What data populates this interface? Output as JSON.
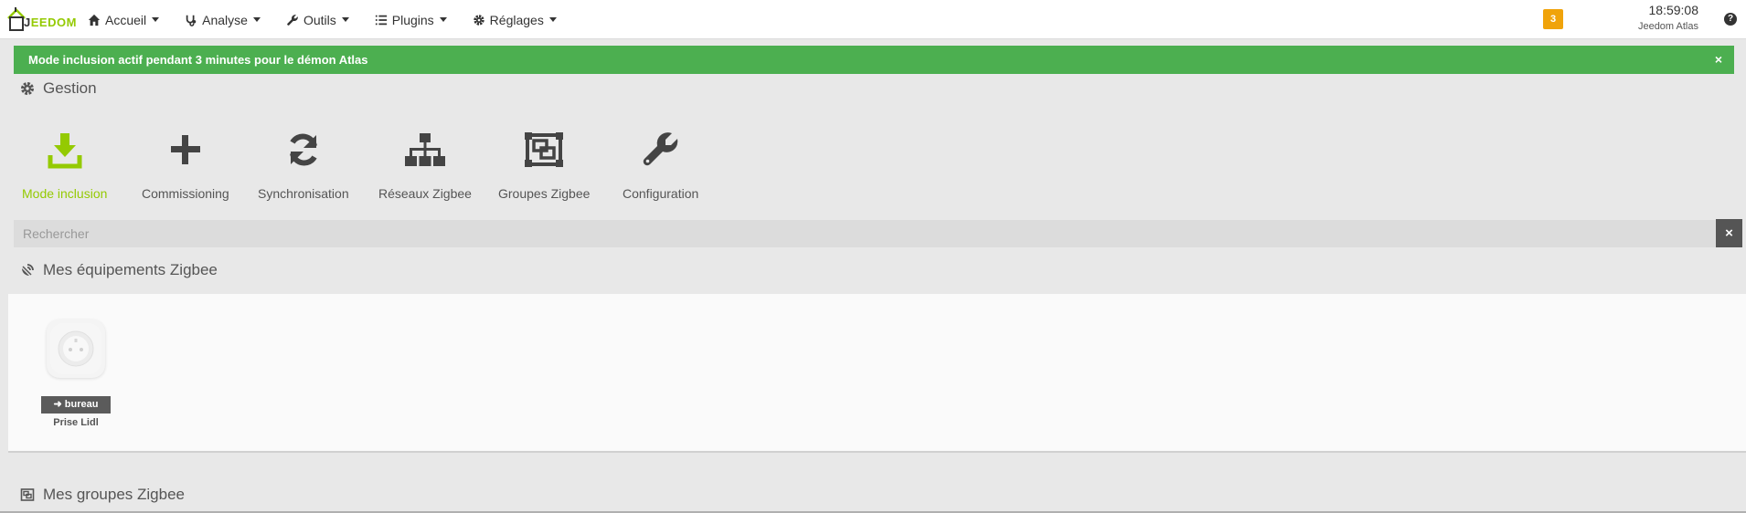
{
  "navbar": {
    "logo_first": "J",
    "logo_rest": "EEDOM",
    "menu": [
      {
        "label": "Accueil",
        "icon": "home-icon"
      },
      {
        "label": "Analyse",
        "icon": "stethoscope-icon"
      },
      {
        "label": "Outils",
        "icon": "wrench-icon"
      },
      {
        "label": "Plugins",
        "icon": "list-icon"
      },
      {
        "label": "Réglages",
        "icon": "gear-icon"
      }
    ],
    "notification_count": "3",
    "time": "18:59:08",
    "host": "Jeedom Atlas"
  },
  "alert": {
    "message": "Mode inclusion actif pendant 3 minutes pour le démon Atlas",
    "close": "×"
  },
  "gestion": {
    "title": "Gestion",
    "actions": [
      {
        "label": "Mode inclusion",
        "icon": "download-icon",
        "active": true
      },
      {
        "label": "Commissioning",
        "icon": "plus-icon"
      },
      {
        "label": "Synchronisation",
        "icon": "refresh-icon"
      },
      {
        "label": "Réseaux Zigbee",
        "icon": "sitemap-icon"
      },
      {
        "label": "Groupes Zigbee",
        "icon": "object-group-icon"
      },
      {
        "label": "Configuration",
        "icon": "wrench-icon"
      }
    ]
  },
  "search": {
    "placeholder": "Rechercher",
    "clear": "×"
  },
  "equipements": {
    "title": "Mes équipements Zigbee",
    "items": [
      {
        "tag": "bureau",
        "name": "Prise Lidl"
      }
    ]
  },
  "groupes": {
    "title": "Mes groupes Zigbee"
  },
  "colors": {
    "accent": "#94ca02",
    "alert_bg": "#4caf50",
    "badge": "#f0a30a"
  }
}
